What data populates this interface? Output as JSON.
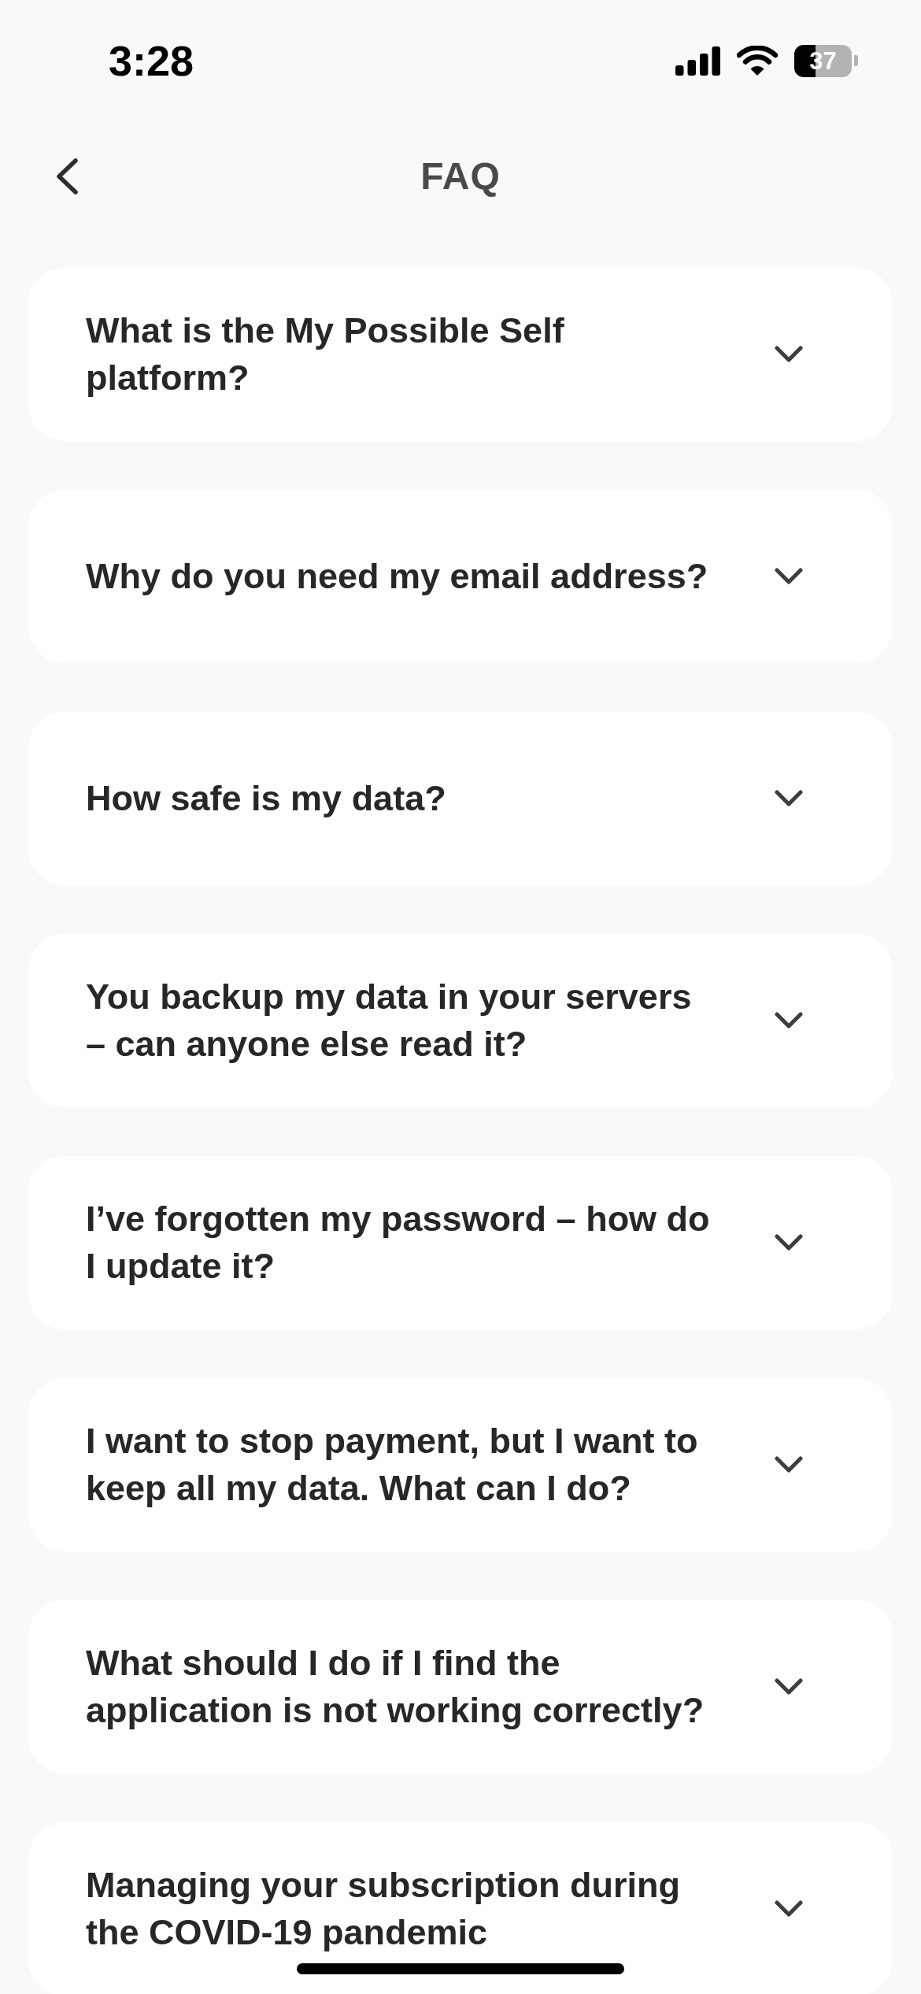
{
  "status_bar": {
    "time": "3:28",
    "battery": "37"
  },
  "header": {
    "title": "FAQ"
  },
  "faq": [
    {
      "question": "What is the My Possible Self platform?",
      "expanded": false
    },
    {
      "question": "Why do you need my email address?",
      "expanded": false
    },
    {
      "question": "How safe is my data?",
      "expanded": false
    },
    {
      "question": "You backup my data in your servers – can anyone else read it?",
      "expanded": false
    },
    {
      "question": "I’ve forgotten my password – how do I update it?",
      "expanded": false
    },
    {
      "question": "I want to stop payment, but I want to keep all my data. What can I do?",
      "expanded": false
    },
    {
      "question": "What should I do if I find the application is not working correctly?",
      "expanded": false
    },
    {
      "question": "Managing your subscription during the COVID-19 pandemic",
      "expanded": false
    }
  ]
}
